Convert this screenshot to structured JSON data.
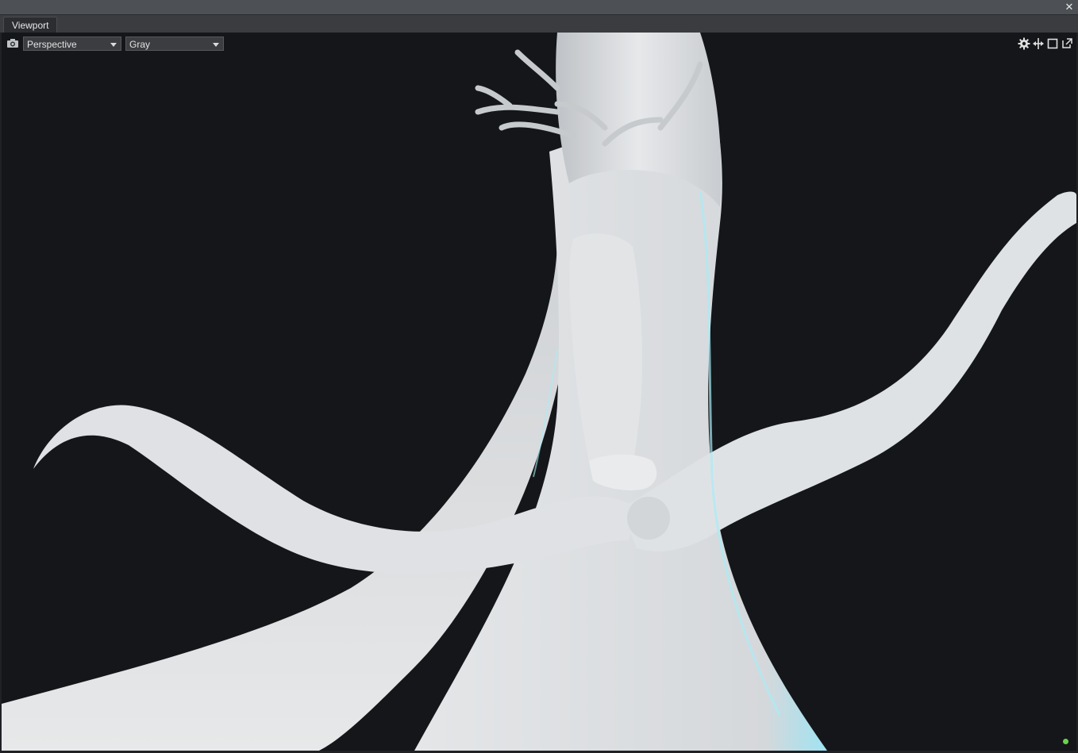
{
  "window": {
    "close_icon": "close-icon",
    "close_glyph": "✕"
  },
  "tabs": [
    {
      "label": "Viewport",
      "active": true
    }
  ],
  "toolbar": {
    "camera_icon": "camera-icon",
    "projection": {
      "value": "Perspective"
    },
    "shading": {
      "value": "Gray"
    },
    "right_icons": [
      "gear-icon",
      "move-arrows-icon",
      "maximize-icon",
      "popout-icon"
    ]
  },
  "viewport": {
    "background": "#141619",
    "status_color": "#6cd24a"
  }
}
